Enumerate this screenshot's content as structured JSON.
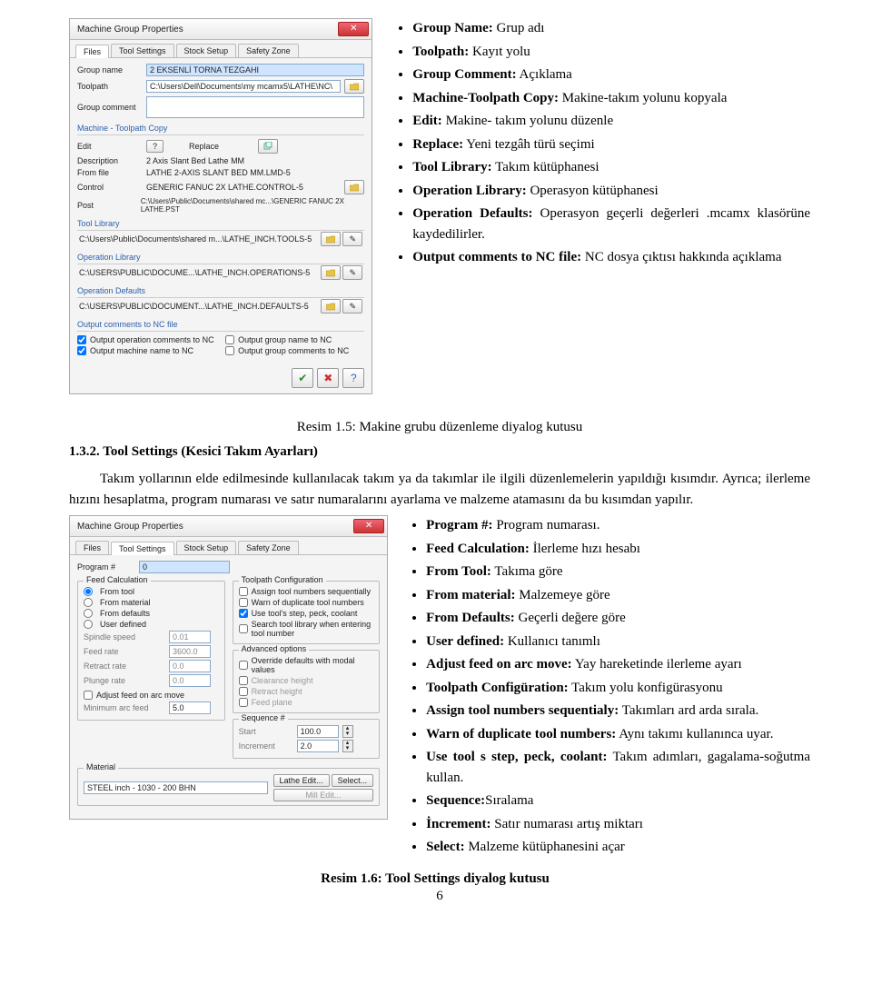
{
  "dialog1": {
    "title": "Machine Group Properties",
    "tabs": [
      "Files",
      "Tool Settings",
      "Stock Setup",
      "Safety Zone"
    ],
    "group_name_label": "Group name",
    "group_name_value": "2 EKSENLİ TORNA TEZGAHI",
    "toolpath_label": "Toolpath",
    "toolpath_value": "C:\\Users\\Dell\\Documents\\my mcamx5\\LATHE\\NC\\",
    "group_comment_label": "Group comment",
    "mtp_header": "Machine - Toolpath Copy",
    "edit_label": "Edit",
    "edit_btn": "?",
    "replace_label": "Replace",
    "desc_label": "Description",
    "desc_value": "2 Axis Slant Bed Lathe MM",
    "fromfile_label": "From file",
    "fromfile_value": "LATHE 2-AXIS SLANT BED MM.LMD-5",
    "control_label": "Control",
    "control_value": "GENERIC FANUC 2X LATHE.CONTROL-5",
    "post_label": "Post",
    "post_value": "C:\\Users\\Public\\Documents\\shared mc...\\GENERIC FANUC 2X LATHE.PST",
    "tool_lib_header": "Tool Library",
    "tool_lib_path": "C:\\Users\\Public\\Documents\\shared m...\\LATHE_INCH.TOOLS-5",
    "op_lib_header": "Operation Library",
    "op_lib_path": "C:\\USERS\\PUBLIC\\DOCUME...\\LATHE_INCH.OPERATIONS-5",
    "op_def_header": "Operation Defaults",
    "op_def_path": "C:\\USERS\\PUBLIC\\DOCUMENT...\\LATHE_INCH.DEFAULTS-5",
    "output_hdr": "Output comments to NC file",
    "chk_op_comments": "Output operation comments to NC",
    "chk_machine_name": "Output machine name to NC",
    "chk_group_name": "Output group name to NC",
    "chk_group_comments": "Output group comments to NC"
  },
  "bullets1": [
    {
      "b": "Group Name:",
      "t": " Grup adı"
    },
    {
      "b": "Toolpath:",
      "t": " Kayıt yolu"
    },
    {
      "b": "Group Comment:",
      "t": " Açıklama"
    },
    {
      "b": "Machine-Toolpath Copy:",
      "t": " Makine-takım yolunu kopyala"
    },
    {
      "b": "Edit:",
      "t": " Makine- takım yolunu düzenle"
    },
    {
      "b": "Replace:",
      "t": " Yeni tezgâh türü seçimi"
    },
    {
      "b": "Tool Library:",
      "t": " Takım kütüphanesi"
    },
    {
      "b": "Operation Library:",
      "t": " Operasyon kütüphanesi"
    },
    {
      "b": "Operation Defaults:",
      "t": " Operasyon geçerli değerleri .mcamx klasörüne kaydedilirler."
    },
    {
      "b": "Output comments to NC file:",
      "t": " NC dosya çıktısı hakkında açıklama"
    }
  ],
  "caption1": "Resim 1.5: Makine grubu düzenleme diyalog kutusu",
  "section_heading": "1.3.2. Tool Settings (Kesici Takım Ayarları)",
  "para1": "Takım yollarının elde edilmesinde kullanılacak takım ya da takımlar ile ilgili düzenlemelerin yapıldığı kısımdır. Ayrıca; ilerleme hızını hesaplatma, program numarası ve satır numaralarını ayarlama ve malzeme atamasını da bu kısımdan yapılır.",
  "dialog2": {
    "title": "Machine Group Properties",
    "tabs": [
      "Files",
      "Tool Settings",
      "Stock Setup",
      "Safety Zone"
    ],
    "program_label": "Program #",
    "program_value": "0",
    "feed_calc_label": "Feed Calculation",
    "radios": [
      "From tool",
      "From material",
      "From defaults",
      "User defined"
    ],
    "spindle_speed_label": "Spindle speed",
    "spindle_speed_value": "0.01",
    "feed_rate_label": "Feed rate",
    "feed_rate_value": "3600.0",
    "retract_rate_label": "Retract rate",
    "retract_rate_value": "0.0",
    "plunge_rate_label": "Plunge rate",
    "plunge_rate_value": "0.0",
    "adjust_feed_label": "Adjust feed on arc move",
    "min_arc_feed_label": "Minimum arc feed",
    "min_arc_feed_value": "5.0",
    "tp_cfg_label": "Toolpath Configuration",
    "tp_chk1": "Assign tool numbers sequentially",
    "tp_chk2": "Warn of duplicate tool numbers",
    "tp_chk3": "Use tool's step, peck, coolant",
    "tp_chk4": "Search tool library when entering tool number",
    "adv_label": "Advanced options",
    "adv_chk1": "Override defaults with modal values",
    "adv_chk2": "Clearance height",
    "adv_chk3": "Retract height",
    "adv_chk4": "Feed plane",
    "seq_label": "Sequence #",
    "seq_start_label": "Start",
    "seq_start_value": "100.0",
    "seq_inc_label": "Increment",
    "seq_inc_value": "2.0",
    "material_label": "Material",
    "material_value": "STEEL inch - 1030 - 200 BHN",
    "btn_lathe_edit": "Lathe Edit...",
    "btn_select": "Select...",
    "btn_mill_edit": "Mill Edit..."
  },
  "bullets2": [
    {
      "b": "Program #:",
      "t": " Program numarası."
    },
    {
      "b": "Feed Calculation:",
      "t": " İlerleme hızı hesabı"
    },
    {
      "b": "From Tool:",
      "t": " Takıma göre"
    },
    {
      "b": "From material:",
      "t": " Malzemeye göre"
    },
    {
      "b": "From Defaults:",
      "t": " Geçerli değere göre"
    },
    {
      "b": "User defined:",
      "t": " Kullanıcı tanımlı"
    },
    {
      "b": "Adjust feed on arc move:",
      "t": " Yay hareketinde ilerleme ayarı"
    },
    {
      "b": "Toolpath Configüration:",
      "t": " Takım yolu konfigürasyonu"
    },
    {
      "b": "Assign tool numbers sequentialy:",
      "t": " Takımları ard arda sırala."
    },
    {
      "b": "Warn of duplicate tool numbers:",
      "t": " Aynı takımı kullanınca uyar."
    },
    {
      "b": "Use tool s step, peck, coolant:",
      "t": " Takım adımları, gagalama-soğutma kullan."
    },
    {
      "b": "Sequence:",
      "t": "Sıralama"
    },
    {
      "b": "İncrement:",
      "t": " Satır numarası artış miktarı"
    },
    {
      "b": "Select:",
      "t": " Malzeme kütüphanesini açar"
    }
  ],
  "caption2": "Resim 1.6: Tool Settings diyalog kutusu",
  "pagenum": "6"
}
